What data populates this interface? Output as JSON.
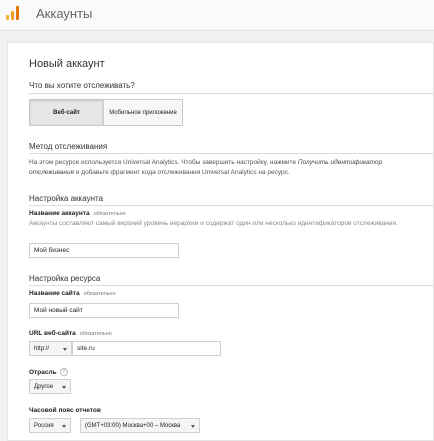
{
  "header": {
    "title": "Аккаунты",
    "logo_icon": "analytics-logo-icon"
  },
  "form": {
    "title": "Новый аккаунт",
    "track_question": "Что вы хотите отслеживать?",
    "track_options": [
      "Веб-сайт",
      "Мобильное приложение"
    ],
    "track_selected": "Веб-сайт",
    "method": {
      "title": "Метод отслеживания",
      "text_before": "На этом ресурсе используется Universal Analytics. Чтобы завершить настройку, нажмите ",
      "text_link": "Получить идентификатор отслеживания",
      "text_after": " и добавьте фрагмент кода отслеживания Universal Analytics на ресурс."
    },
    "account": {
      "section_title": "Настройка аккаунта",
      "name_label": "Название аккаунта",
      "required": "обязательно",
      "name_hint": "Аккаунты составляют самый верхний уровень иерархии и содержат один или несколько идентификаторов отслеживания.",
      "name_value": "Мой бизнес"
    },
    "property": {
      "section_title": "Настройка ресурса",
      "site_name_label": "Название сайта",
      "site_name_value": "Мой новый сайт",
      "url_label": "URL веб-сайта",
      "protocol": "http://",
      "url_value": "site.ru",
      "industry_label": "Отрасль",
      "industry_help_icon": "question-circle-icon",
      "industry_value": "Другое",
      "timezone_label": "Часовой пояс отчетов",
      "country_value": "Россия",
      "timezone_value": "(GMT+03:00) Москва+00 – Москва"
    }
  }
}
